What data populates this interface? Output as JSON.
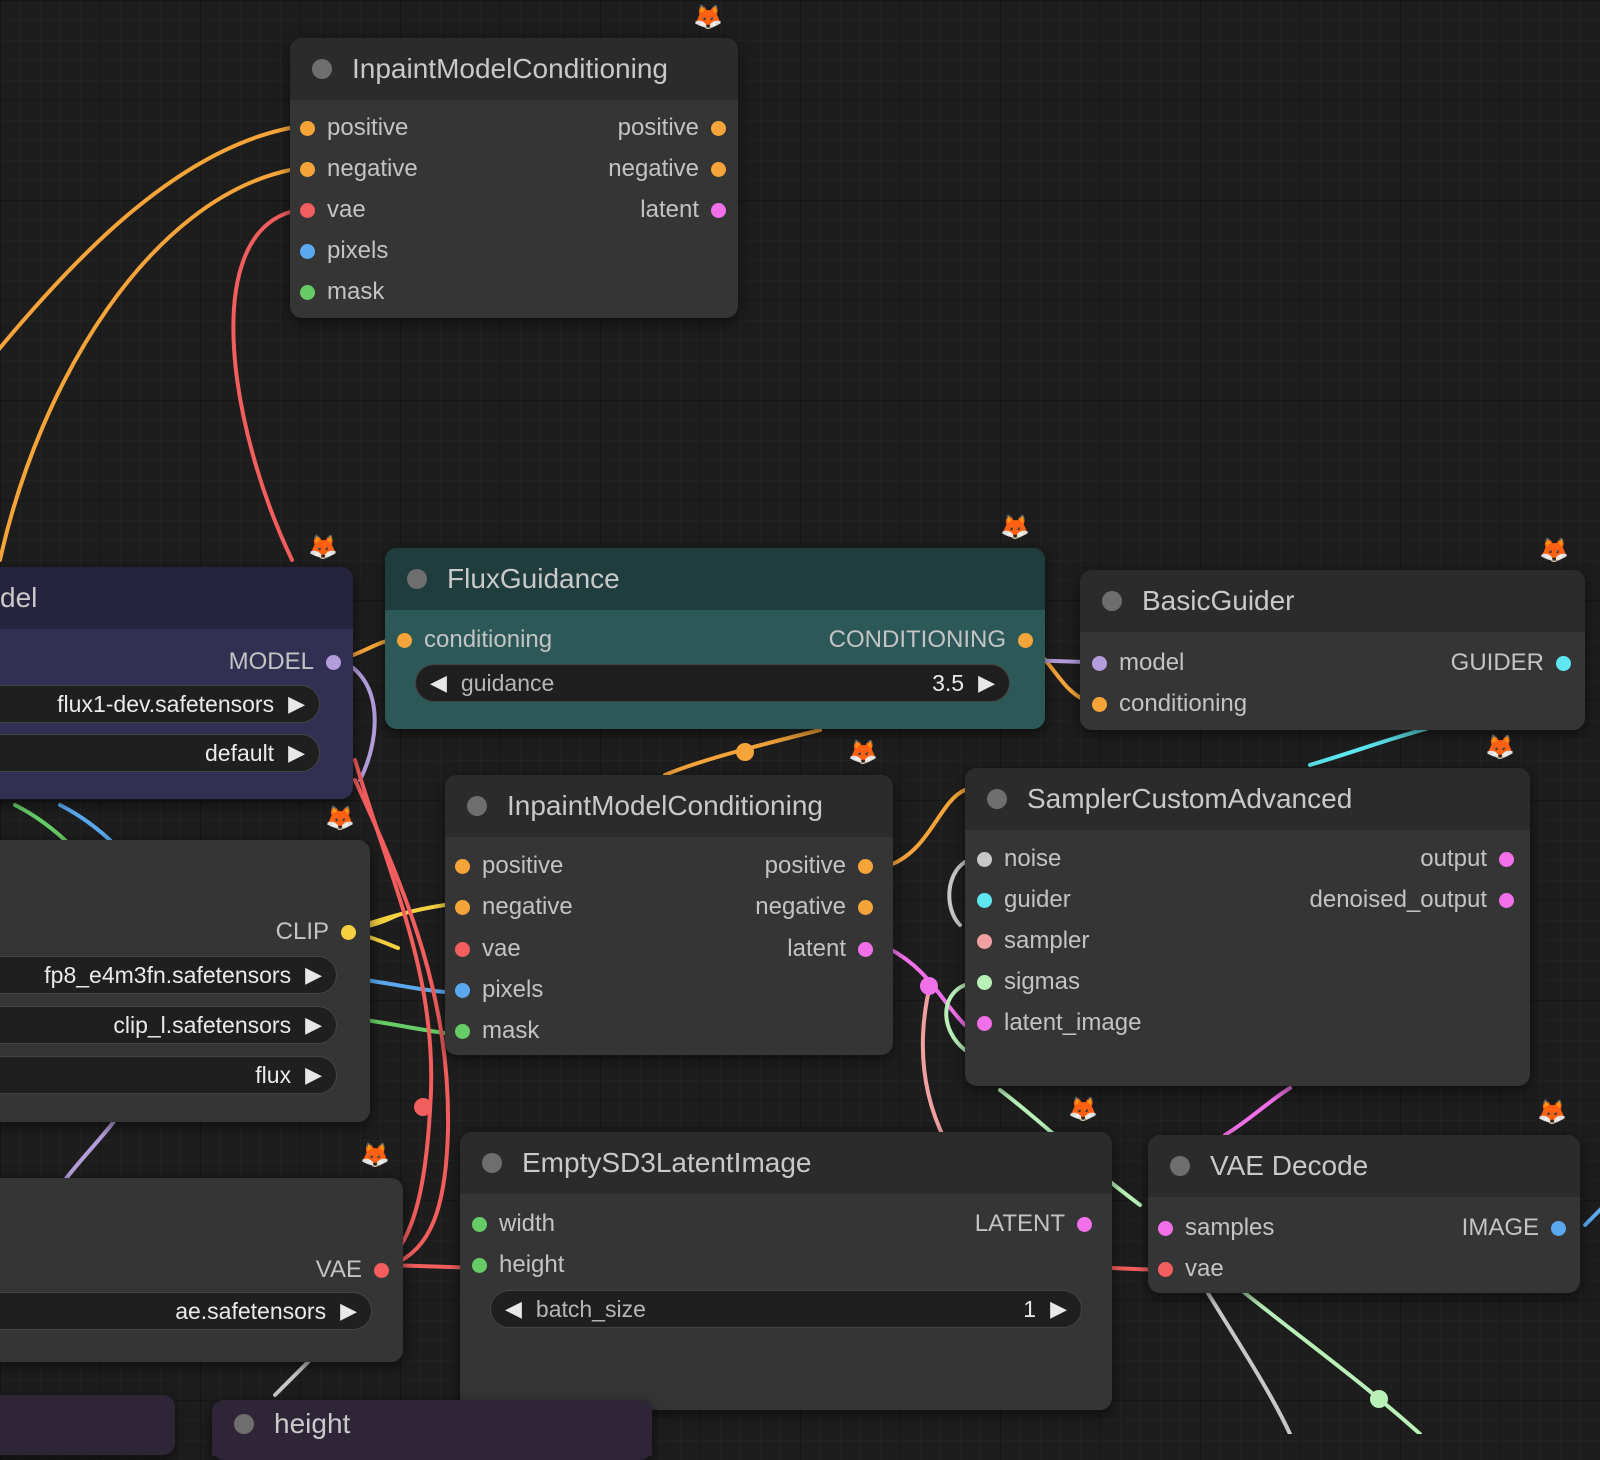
{
  "colors": {
    "canvas": "#1d1d1d",
    "node_body": "#353535",
    "node_header": "#2b2b2b",
    "conditioning": "#f5a43a",
    "latent": "#f170e9",
    "vae": "#f25d5d",
    "image": "#5aa9f0",
    "mask": "#66cc66",
    "model": "#b39ddb",
    "clip": "#f5d142",
    "guider": "#5ee7f0",
    "noise": "#c8c8c8",
    "sampler": "#f0a0a0",
    "sigmas": "#b8f0b8",
    "int": "#66cc66",
    "flux_guidance_body": "#2c5957",
    "flux_guidance_header": "#1f3d3c",
    "model_loader_body": "#323052",
    "model_loader_header": "#25233d"
  },
  "nodes": {
    "inpaint_top": {
      "title": "InpaintModelConditioning",
      "inputs": [
        "positive",
        "negative",
        "vae",
        "pixels",
        "mask"
      ],
      "outputs": [
        "positive",
        "negative",
        "latent"
      ]
    },
    "model_loader": {
      "title_fragment": "del",
      "output": "MODEL",
      "widgets": [
        "flux1-dev.safetensors",
        "default"
      ]
    },
    "flux_guidance": {
      "title": "FluxGuidance",
      "input": "conditioning",
      "output": "CONDITIONING",
      "widget_label": "guidance",
      "widget_value": "3.5"
    },
    "basic_guider": {
      "title": "BasicGuider",
      "inputs": [
        "model",
        "conditioning"
      ],
      "output": "GUIDER"
    },
    "clip_loader": {
      "output": "CLIP",
      "widgets": [
        "fp8_e4m3fn.safetensors",
        "clip_l.safetensors",
        "flux"
      ]
    },
    "inpaint_mid": {
      "title": "InpaintModelConditioning",
      "inputs": [
        "positive",
        "negative",
        "vae",
        "pixels",
        "mask"
      ],
      "outputs": [
        "positive",
        "negative",
        "latent"
      ]
    },
    "sampler_custom_advanced": {
      "title": "SamplerCustomAdvanced",
      "inputs": [
        "noise",
        "guider",
        "sampler",
        "sigmas",
        "latent_image"
      ],
      "outputs": [
        "output",
        "denoised_output"
      ]
    },
    "vae_loader": {
      "output": "VAE",
      "widget": "ae.safetensors"
    },
    "empty_latent": {
      "title": "EmptySD3LatentImage",
      "inputs": [
        "width",
        "height"
      ],
      "output": "LATENT",
      "widget_label": "batch_size",
      "widget_value": "1"
    },
    "vae_decode": {
      "title": "VAE Decode",
      "inputs": [
        "samples",
        "vae"
      ],
      "output": "IMAGE"
    },
    "bottom_partial": {
      "title": "height"
    }
  },
  "icons": {
    "badge": "fox-badge-icon",
    "combo_arrow": "triangle-right-icon",
    "dec_arrow": "triangle-left-icon",
    "inc_arrow": "triangle-right-icon"
  }
}
